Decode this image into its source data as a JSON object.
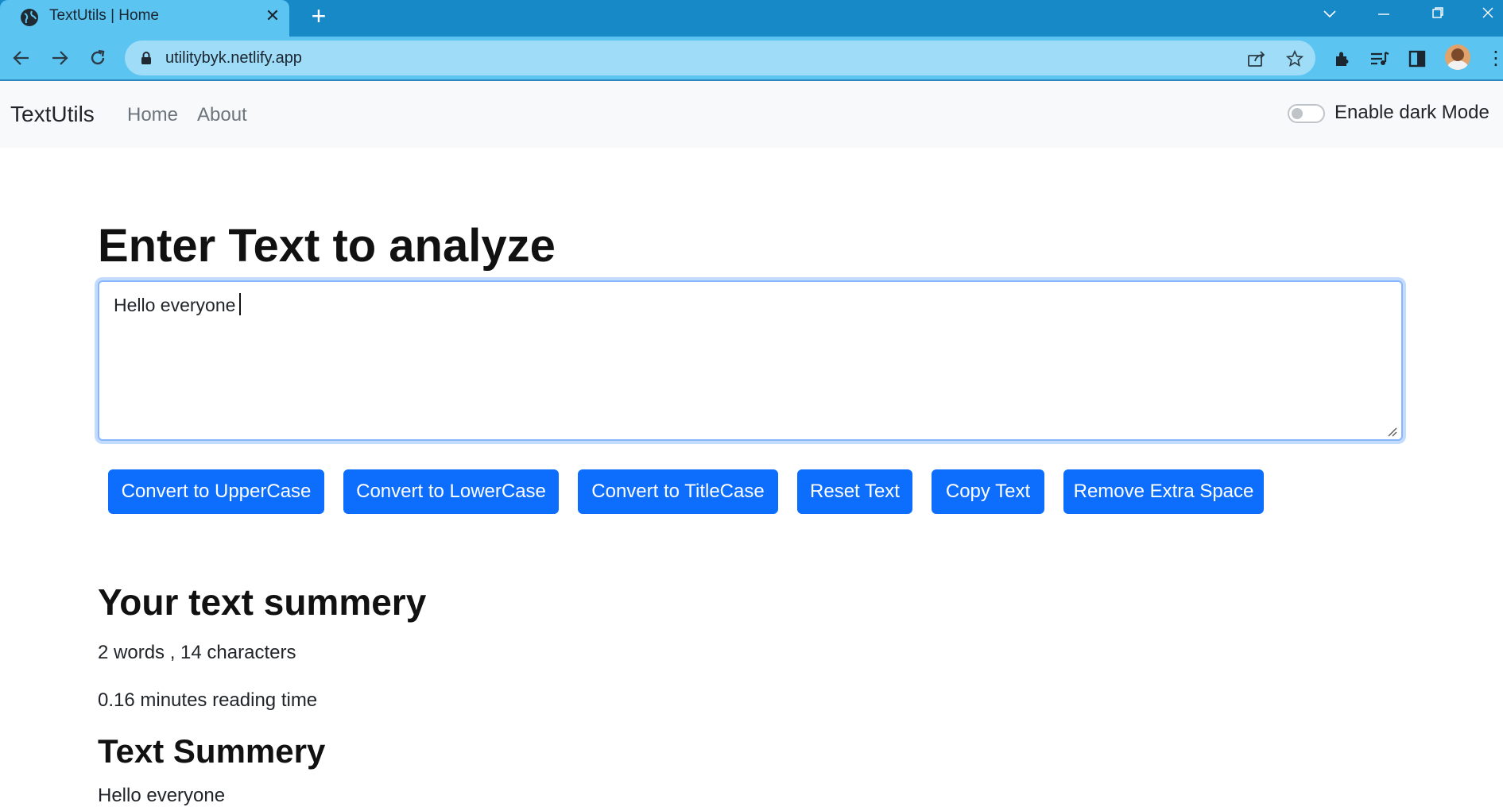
{
  "browser": {
    "tab_title": "TextUtils | Home",
    "url": "utilitybyk.netlify.app",
    "icons": [
      "globe-icon",
      "close-icon",
      "plus-icon",
      "back-icon",
      "forward-icon",
      "reload-icon",
      "lock-icon",
      "share-icon",
      "star-icon",
      "extensions-icon",
      "media-icon",
      "sidepanel-icon",
      "avatar",
      "menu-icon",
      "chevron-down-icon",
      "minimize-icon",
      "restore-icon"
    ],
    "colors": {
      "tabstrip": "#1889c7",
      "toolbar": "#5bc4f1",
      "omnibox": "#9fdcf7"
    }
  },
  "navbar": {
    "brand": "TextUtils",
    "links": [
      "Home",
      "About"
    ],
    "dark_mode_label": "Enable dark Mode",
    "dark_mode_enabled": false
  },
  "main": {
    "heading": "Enter Text to analyze",
    "textarea_value": "Hello everyone",
    "buttons": [
      "Convert to UpperCase",
      "Convert to LowerCase",
      "Convert to TitleCase",
      "Reset Text",
      "Copy Text",
      "Remove Extra Space"
    ],
    "accent_color": "#0d6efd"
  },
  "summary": {
    "heading": "Your text summery",
    "counts": "2 words , 14 characters",
    "reading_time": "0.16 minutes reading time",
    "preview_heading": "Text Summery",
    "preview_text": "Hello everyone"
  }
}
